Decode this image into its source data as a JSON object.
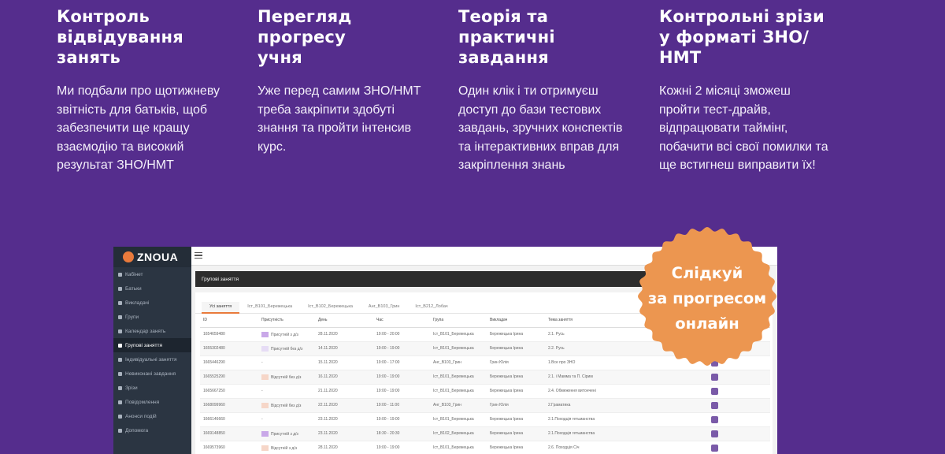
{
  "features": [
    {
      "title": "Контроль\nвідвідування\nзанять",
      "text": "Ми подбали про щотижневу\nзвітність для батьків, щоб\nзабезпечити ще кращу\nвзаємодію та високий\nрезультат ЗНО/НМТ"
    },
    {
      "title": "Перегляд\nпрогресу\nучня",
      "text": "Уже перед самим ЗНО/НМТ\nтреба закріпити здобуті\nзнання та пройти інтенсив\nкурс."
    },
    {
      "title": "Теорія та\nпрактичні\nзавдання",
      "text": "Один клік і ти отримуєш\nдоступ до бази тестових\nзавдань, зручних конспектів\nта інтерактивних вправ для\nзакріплення знань"
    },
    {
      "title": "Контрольні зрізи\nу форматі ЗНО/\nНМТ",
      "text": "Кожні 2 місяці зможеш\nпройти тест-драйв,\nвідпрацювати таймінг,\nпобачити всі свої помилки та\nще встигнеш виправити їх!"
    }
  ],
  "app": {
    "logo": "ZNOUA",
    "nav": [
      "Кабінет",
      "Батьки",
      "Викладачі",
      "Групи",
      "Календар занять",
      "Групові заняття",
      "Індивідуальні заняття",
      "Невиконані завдання",
      "Зрізи",
      "Повідомлення",
      "Анонси подій",
      "Допомога"
    ],
    "active_nav": 5,
    "panel_title": "Групові заняття",
    "tabs": [
      "Усі заняття",
      "Іст_В101_Бережецька",
      "Іст_В102_Бережецька",
      "Анг_В103_Грин",
      "Іст_В212_Лобач"
    ],
    "columns": [
      "ID",
      "Присутність",
      "День",
      "Час",
      "Група",
      "Викладач",
      "Тема заняття"
    ],
    "rows": [
      {
        "id": "1654659480",
        "att": "Присутній з д/з",
        "sw": "#c9a8e8",
        "day": "28.11.2020",
        "time": "19:00 - 20:00",
        "group": "Іст_В101_Бережецька",
        "teacher": "Бережецька Ірина",
        "topic": "2.1. Русь"
      },
      {
        "id": "1655302480",
        "att": "Присутній без д/з",
        "sw": "#e6dcf5",
        "day": "14.11.2020",
        "time": "19:00 - 19:00",
        "group": "Іст_В101_Бережецька",
        "teacher": "Бережецька Ірина",
        "topic": "2.2. Русь"
      },
      {
        "id": "1665446290",
        "att": "-",
        "sw": "",
        "day": "15.11.2020",
        "time": "19:00 - 17:00",
        "group": "Анг_В103_Грин",
        "teacher": "Грин Юлія",
        "topic": "1.Все про ЗНО"
      },
      {
        "id": "1665525290",
        "att": "Відсутній без д/з",
        "sw": "#f6d6c8",
        "day": "16.11.2020",
        "time": "19:00 - 19:00",
        "group": "Іст_В101_Бережецька",
        "teacher": "Бережецька Ірина",
        "topic": "2.1. і Маммa та П. Сірим"
      },
      {
        "id": "1665667250",
        "att": "-",
        "sw": "",
        "day": "21.11.2020",
        "time": "19:00 - 19:00",
        "group": "Іст_В101_Бережецька",
        "teacher": "Бережецька Ірина",
        "topic": "2.4. Обмеження витончені"
      },
      {
        "id": "1668099960",
        "att": "Відсутній без д/з",
        "sw": "#f6d6c8",
        "day": "22.11.2020",
        "time": "19:00 - 11:00",
        "group": "Анг_В103_Грин",
        "teacher": "Грин Юлія",
        "topic": "2.Граматика"
      },
      {
        "id": "1666146660",
        "att": "-",
        "sw": "",
        "day": "23.11.2020",
        "time": "19:00 - 19:00",
        "group": "Іст_В101_Бережецька",
        "teacher": "Бережецька Ірина",
        "topic": "2.1.Походція гетьманства"
      },
      {
        "id": "1669148850",
        "att": "Присутній з д/з",
        "sw": "#c9a8e8",
        "day": "23.11.2020",
        "time": "18:30 - 20:30",
        "group": "Іст_В102_Бережецька",
        "teacher": "Бережецька Ірина",
        "topic": "2.1.Походція гетьманства"
      },
      {
        "id": "1669573960",
        "att": "Відсутній з д/з",
        "sw": "#f6d6c8",
        "day": "28.11.2020",
        "time": "19:00 - 19:00",
        "group": "Іст_В101_Бережецька",
        "teacher": "Бережецька Ірина",
        "topic": "2.6. Походція Січ"
      }
    ]
  },
  "badge": {
    "text": "Слідкуй\nза прогресом\nонлайн",
    "color": "#ec9650"
  },
  "colors": {
    "background": "#552d8d",
    "accent": "#e97a3c"
  }
}
